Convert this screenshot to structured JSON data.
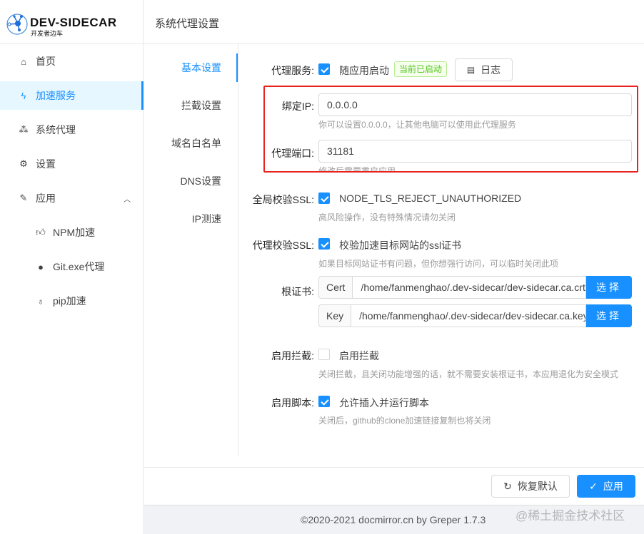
{
  "app": {
    "logo_text": "DEV-SIDECAR",
    "logo_sub": "开发者边车",
    "page_title": "系统代理设置"
  },
  "sidebar": {
    "items": [
      {
        "label": "首页",
        "icon": "home-icon"
      },
      {
        "label": "加速服务",
        "icon": "thunderbolt-icon"
      },
      {
        "label": "系统代理",
        "icon": "network-icon"
      },
      {
        "label": "设置",
        "icon": "gear-icon"
      },
      {
        "label": "应用",
        "icon": "rocket-icon"
      },
      {
        "label": "NPM加速",
        "icon": "thumbs-up-icon"
      },
      {
        "label": "Git.exe代理",
        "icon": "github-icon"
      },
      {
        "label": "pip加速",
        "icon": "bulb-icon"
      }
    ]
  },
  "tabs": [
    "基本设置",
    "拦截设置",
    "域名白名单",
    "DNS设置",
    "IP测速"
  ],
  "form": {
    "proxy_service": {
      "label": "代理服务:",
      "checkbox": "随应用启动",
      "checked": true,
      "status": "当前已启动",
      "log_button": "日志"
    },
    "bind_ip": {
      "label": "绑定IP:",
      "value": "0.0.0.0",
      "hint": "你可以设置0.0.0.0，让其他电脑可以使用此代理服务"
    },
    "port": {
      "label": "代理端口:",
      "value": "31181",
      "hint": "修改后需要重启应用"
    },
    "global_ssl": {
      "label": "全局校验SSL:",
      "checkbox": "NODE_TLS_REJECT_UNAUTHORIZED",
      "checked": true,
      "hint": "高风险操作，没有特殊情况请勿关闭"
    },
    "proxy_ssl": {
      "label": "代理校验SSL:",
      "checkbox": "校验加速目标网站的ssl证书",
      "checked": true,
      "hint": "如果目标网站证书有问题，但你想强行访问，可以临时关闭此项"
    },
    "root_cert": {
      "label": "根证书:",
      "cert_addon": "Cert",
      "cert_value": "/home/fanmenghao/.dev-sidecar/dev-sidecar.ca.crt",
      "key_addon": "Key",
      "key_value": "/home/fanmenghao/.dev-sidecar/dev-sidecar.ca.key.pem",
      "select_label": "选择"
    },
    "intercept": {
      "label": "启用拦截:",
      "checkbox": "启用拦截",
      "checked": false,
      "hint": "关闭拦截，且关闭功能增强的话，就不需要安装根证书，本应用退化为安全模式"
    },
    "script": {
      "label": "启用脚本:",
      "checkbox": "允许插入并运行脚本",
      "checked": true,
      "hint": "关闭后，github的clone加速链接复制也将关闭"
    }
  },
  "actions": {
    "reset": "恢复默认",
    "apply": "应用"
  },
  "footer": {
    "copyright": "©2020-2021 docmirror.cn by Greper 1.7.3",
    "watermark": "@稀土掘金技术社区"
  }
}
